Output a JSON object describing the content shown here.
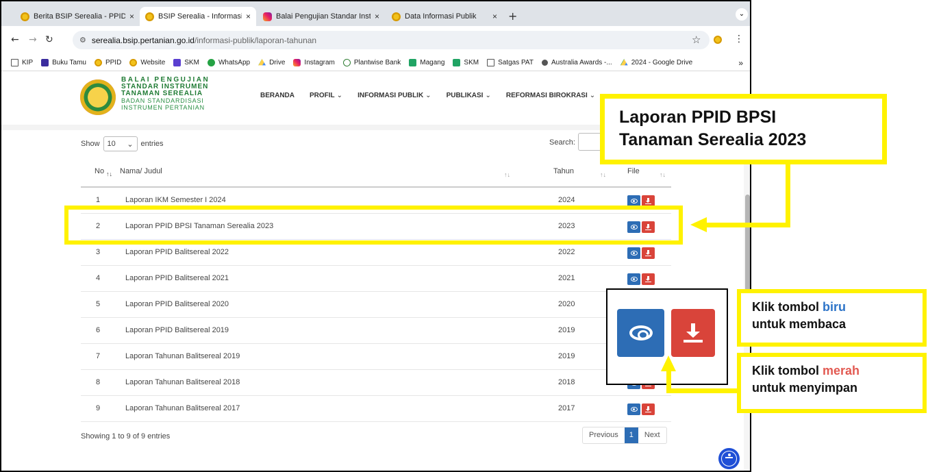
{
  "browser": {
    "tabs": [
      {
        "label": "Berita BSIP Serealia - PPID U",
        "close": "×"
      },
      {
        "label": "BSIP Serealia - Informasi Publ",
        "close": "×"
      },
      {
        "label": "Balai Pengujian Standar Instru",
        "close": "×"
      },
      {
        "label": "Data Informasi Publik",
        "close": "×"
      }
    ],
    "new_tab": "+",
    "tab_menu": "⌄",
    "url_host": "serealia.bsip.pertanian.go.id",
    "url_path": "/informasi-publik/laporan-tahunan",
    "bookmarks": [
      {
        "label": "KIP",
        "icon": "folder-icon"
      },
      {
        "label": "Buku Tamu",
        "icon": "book-icon"
      },
      {
        "label": "PPID",
        "icon": "sun-icon"
      },
      {
        "label": "Website",
        "icon": "sun-icon"
      },
      {
        "label": "SKM",
        "icon": "form-icon"
      },
      {
        "label": "WhatsApp",
        "icon": "whatsapp-icon"
      },
      {
        "label": "Drive",
        "icon": "drive-icon"
      },
      {
        "label": "Instagram",
        "icon": "instagram-icon"
      },
      {
        "label": "Plantwise Bank",
        "icon": "plant-icon"
      },
      {
        "label": "Magang",
        "icon": "sheet-icon"
      },
      {
        "label": "SKM",
        "icon": "sheet-icon"
      },
      {
        "label": "Satgas PAT",
        "icon": "folder-icon"
      },
      {
        "label": "Australia Awards -...",
        "icon": "globe-icon"
      },
      {
        "label": "2024 - Google Drive",
        "icon": "drive-icon"
      }
    ],
    "bookmarks_more": "»"
  },
  "site": {
    "logo_lines": [
      "BALAI PENGUJIAN",
      "STANDAR INSTRUMEN",
      "TANAMAN SEREALIA",
      "BADAN STANDARDISASI",
      "INSTRUMEN PERTANIAN"
    ],
    "nav": [
      {
        "label": "BERANDA",
        "chevron": ""
      },
      {
        "label": "PROFIL",
        "chevron": "⌄"
      },
      {
        "label": "INFORMASI PUBLIK",
        "chevron": "⌄"
      },
      {
        "label": "PUBLIKASI",
        "chevron": "⌄"
      },
      {
        "label": "REFORMASI BIROKRASI",
        "chevron": "⌄"
      }
    ]
  },
  "table": {
    "show_label": "Show",
    "entries_value": "10",
    "entries_label": "entries",
    "search_label": "Search:",
    "columns": {
      "no": "No",
      "title": "Nama/ Judul",
      "year": "Tahun",
      "file": "File"
    },
    "sort_glyph": "↑↓",
    "rows": [
      {
        "no": "1",
        "title": "Laporan IKM Semester I 2024",
        "year": "2024"
      },
      {
        "no": "2",
        "title": "Laporan PPID BPSI Tanaman Serealia 2023",
        "year": "2023"
      },
      {
        "no": "3",
        "title": "Laporan PPID Balitsereal 2022",
        "year": "2022"
      },
      {
        "no": "4",
        "title": "Laporan PPID Balitsereal 2021",
        "year": "2021"
      },
      {
        "no": "5",
        "title": "Laporan PPID Balitsereal 2020",
        "year": "2020"
      },
      {
        "no": "6",
        "title": "Laporan PPID Balitsereal 2019",
        "year": "2019"
      },
      {
        "no": "7",
        "title": "Laporan Tahunan Balitsereal 2019",
        "year": "2019"
      },
      {
        "no": "8",
        "title": "Laporan Tahunan Balitsereal 2018",
        "year": "2018"
      },
      {
        "no": "9",
        "title": "Laporan Tahunan Balitsereal 2017",
        "year": "2017"
      }
    ],
    "info": "Showing 1 to 9 of 9 entries",
    "pager": {
      "previous": "Previous",
      "current": "1",
      "next": "Next"
    }
  },
  "annotations": {
    "callout_line1": "Laporan PPID BPSI",
    "callout_line2": "Tanaman Serealia 2023",
    "note_blue_prefix": "Klik tombol ",
    "note_blue_word": "biru",
    "note_blue_suffix": "untuk membaca",
    "note_red_prefix": "Klik tombol ",
    "note_red_word": "merah",
    "note_red_suffix": "untuk menyimpan"
  },
  "colors": {
    "highlight": "#fff200",
    "view_button": "#2d6db5",
    "download_button": "#d9443a",
    "brand_green": "#1e7a33"
  }
}
